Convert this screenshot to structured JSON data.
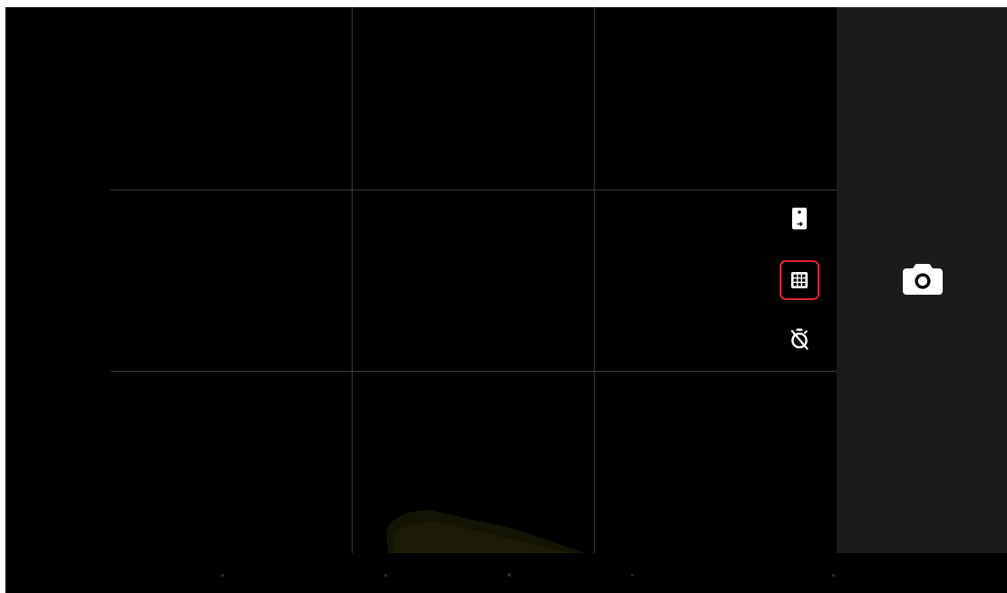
{
  "app": {
    "name": "Camera"
  },
  "viewfinder": {
    "grid_overlay": "3x3"
  },
  "controls": [
    {
      "name": "switch-camera",
      "icon": "phone-rotate-icon",
      "active": false
    },
    {
      "name": "grid",
      "icon": "grid-icon",
      "active": true,
      "highlight_color": "#e2202a"
    },
    {
      "name": "timer",
      "icon": "timer-off-icon",
      "active": false
    }
  ],
  "shutter": {
    "icon": "camera-icon"
  },
  "colors": {
    "viewfinder_background": "#000000",
    "shutter_panel_background": "#1b1b1b",
    "grid_line": "#3a3a3a",
    "icon": "#ffffff",
    "selection_highlight": "#e2202a"
  }
}
